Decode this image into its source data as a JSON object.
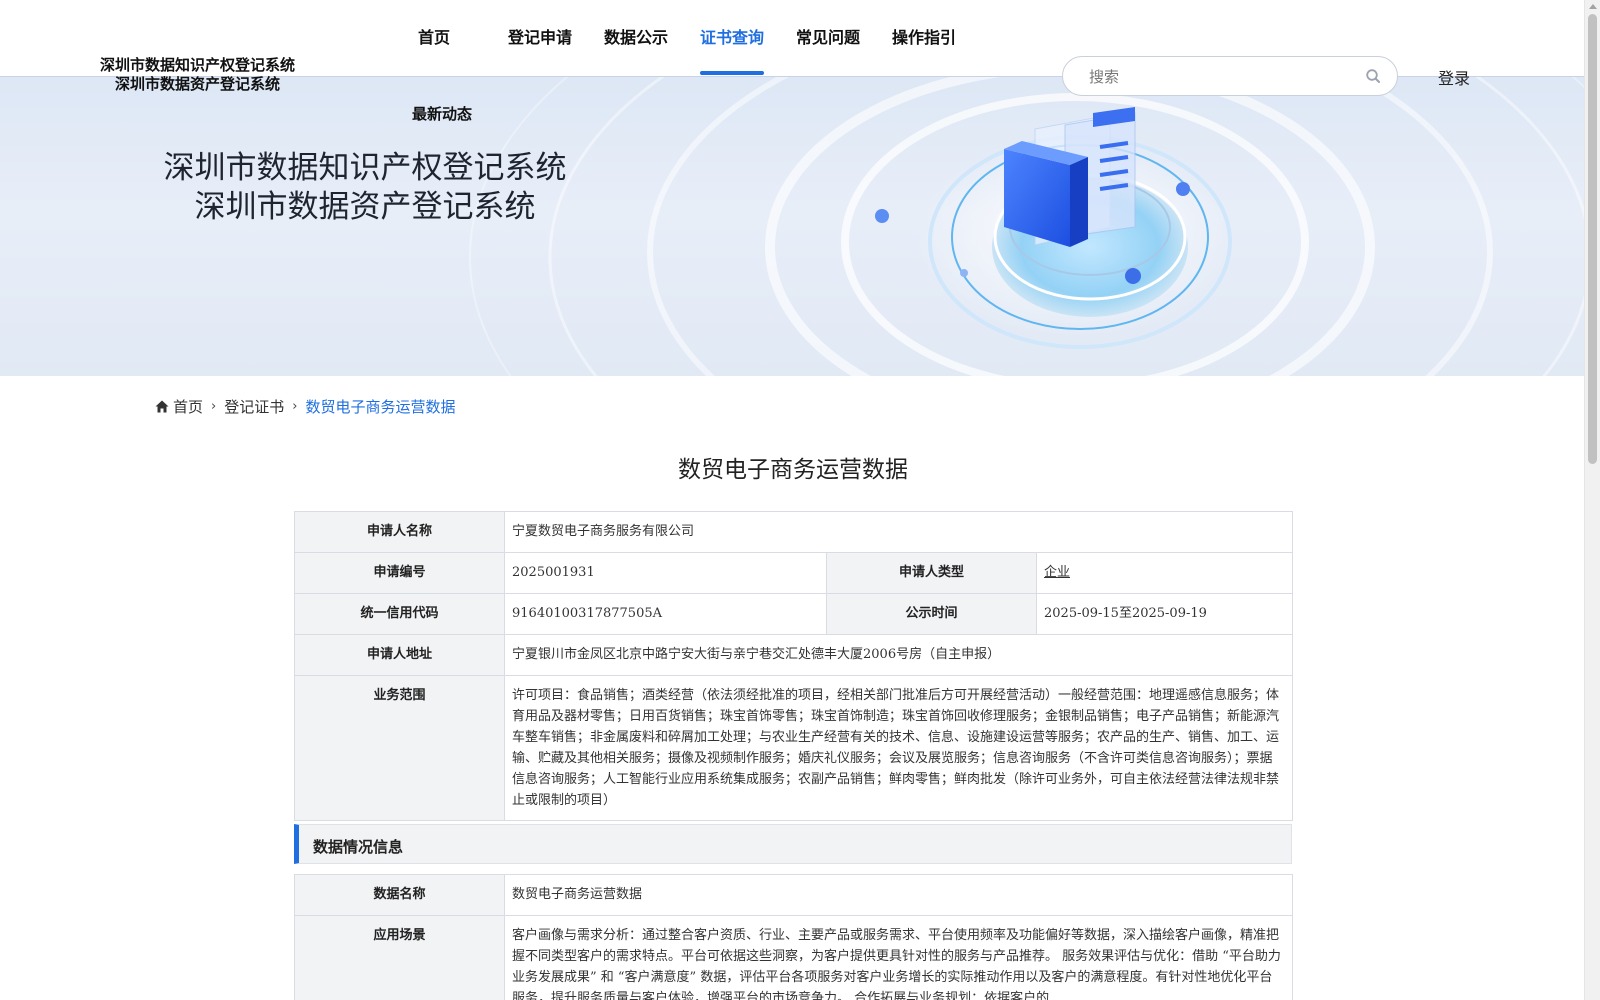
{
  "header": {
    "logo_line1": "深圳市数据知识产权登记系统",
    "logo_line2": "深圳市数据资产登记系统",
    "nav": [
      {
        "label": "首页"
      },
      {
        "label": "登记申请"
      },
      {
        "label": "数据公示"
      },
      {
        "label": "证书查询"
      },
      {
        "label": "常见问题"
      },
      {
        "label": "操作指引"
      },
      {
        "label": "最新动态"
      }
    ],
    "active_nav": "证书查询",
    "search_placeholder": "搜索",
    "login_label": "登录",
    "accent_color": "#1f6fe0"
  },
  "banner": {
    "title_line1": "深圳市数据知识产权登记系统",
    "title_line2": "深圳市数据资产登记系统"
  },
  "breadcrumb": {
    "home": "首页",
    "level2": "登记证书",
    "current": "数贸电子商务运营数据"
  },
  "page_title": "数贸电子商务运营数据",
  "applicant": {
    "name_label": "申请人名称",
    "name_value": "宁夏数贸电子商务服务有限公司",
    "app_no_label": "申请编号",
    "app_no_value": "2025001931",
    "type_label": "申请人类型",
    "type_value": "企业",
    "credit_label": "统一信用代码",
    "credit_value": "91640100317877505A",
    "publicity_label": "公示时间",
    "publicity_value": "2025-09-15至2025-09-19",
    "address_label": "申请人地址",
    "address_value": "宁夏银川市金凤区北京中路宁安大街与亲宁巷交汇处德丰大厦2006号房（自主申报）",
    "scope_label": "业务范围",
    "scope_value": "许可项目：食品销售；酒类经营（依法须经批准的项目，经相关部门批准后方可开展经营活动）一般经营范围：地理遥感信息服务；体育用品及器材零售；日用百货销售；珠宝首饰零售；珠宝首饰制造；珠宝首饰回收修理服务；金银制品销售；电子产品销售；新能源汽车整车销售；非金属废料和碎屑加工处理；与农业生产经营有关的技术、信息、设施建设运营等服务；农产品的生产、销售、加工、运输、贮藏及其他相关服务；摄像及视频制作服务；婚庆礼仪服务；会议及展览服务；信息咨询服务（不含许可类信息咨询服务）；票据信息咨询服务；人工智能行业应用系统集成服务；农副产品销售；鲜肉零售；鲜肉批发（除许可业务外，可自主依法经营法律法规非禁止或限制的项目）"
  },
  "data_section": {
    "title": "数据情况信息",
    "data_name_label": "数据名称",
    "data_name_value": "数贸电子商务运营数据",
    "scenario_label": "应用场景",
    "scenario_value": "客户画像与需求分析：通过整合客户资质、行业、主要产品或服务需求、平台使用频率及功能偏好等数据，深入描绘客户画像，精准把握不同类型客户的需求特点。平台可依据这些洞察，为客户提供更具针对性的服务与产品推荐。 服务效果评估与优化：借助 “平台助力业务发展成果” 和 “客户满意度” 数据，评估平台各项服务对客户业务增长的实际推动作用以及客户的满意程度。有针对性地优化平台服务，提升服务质量与客户体验，增强平台的市场竞争力。 合作拓展与业务规划：依据客户的"
  }
}
